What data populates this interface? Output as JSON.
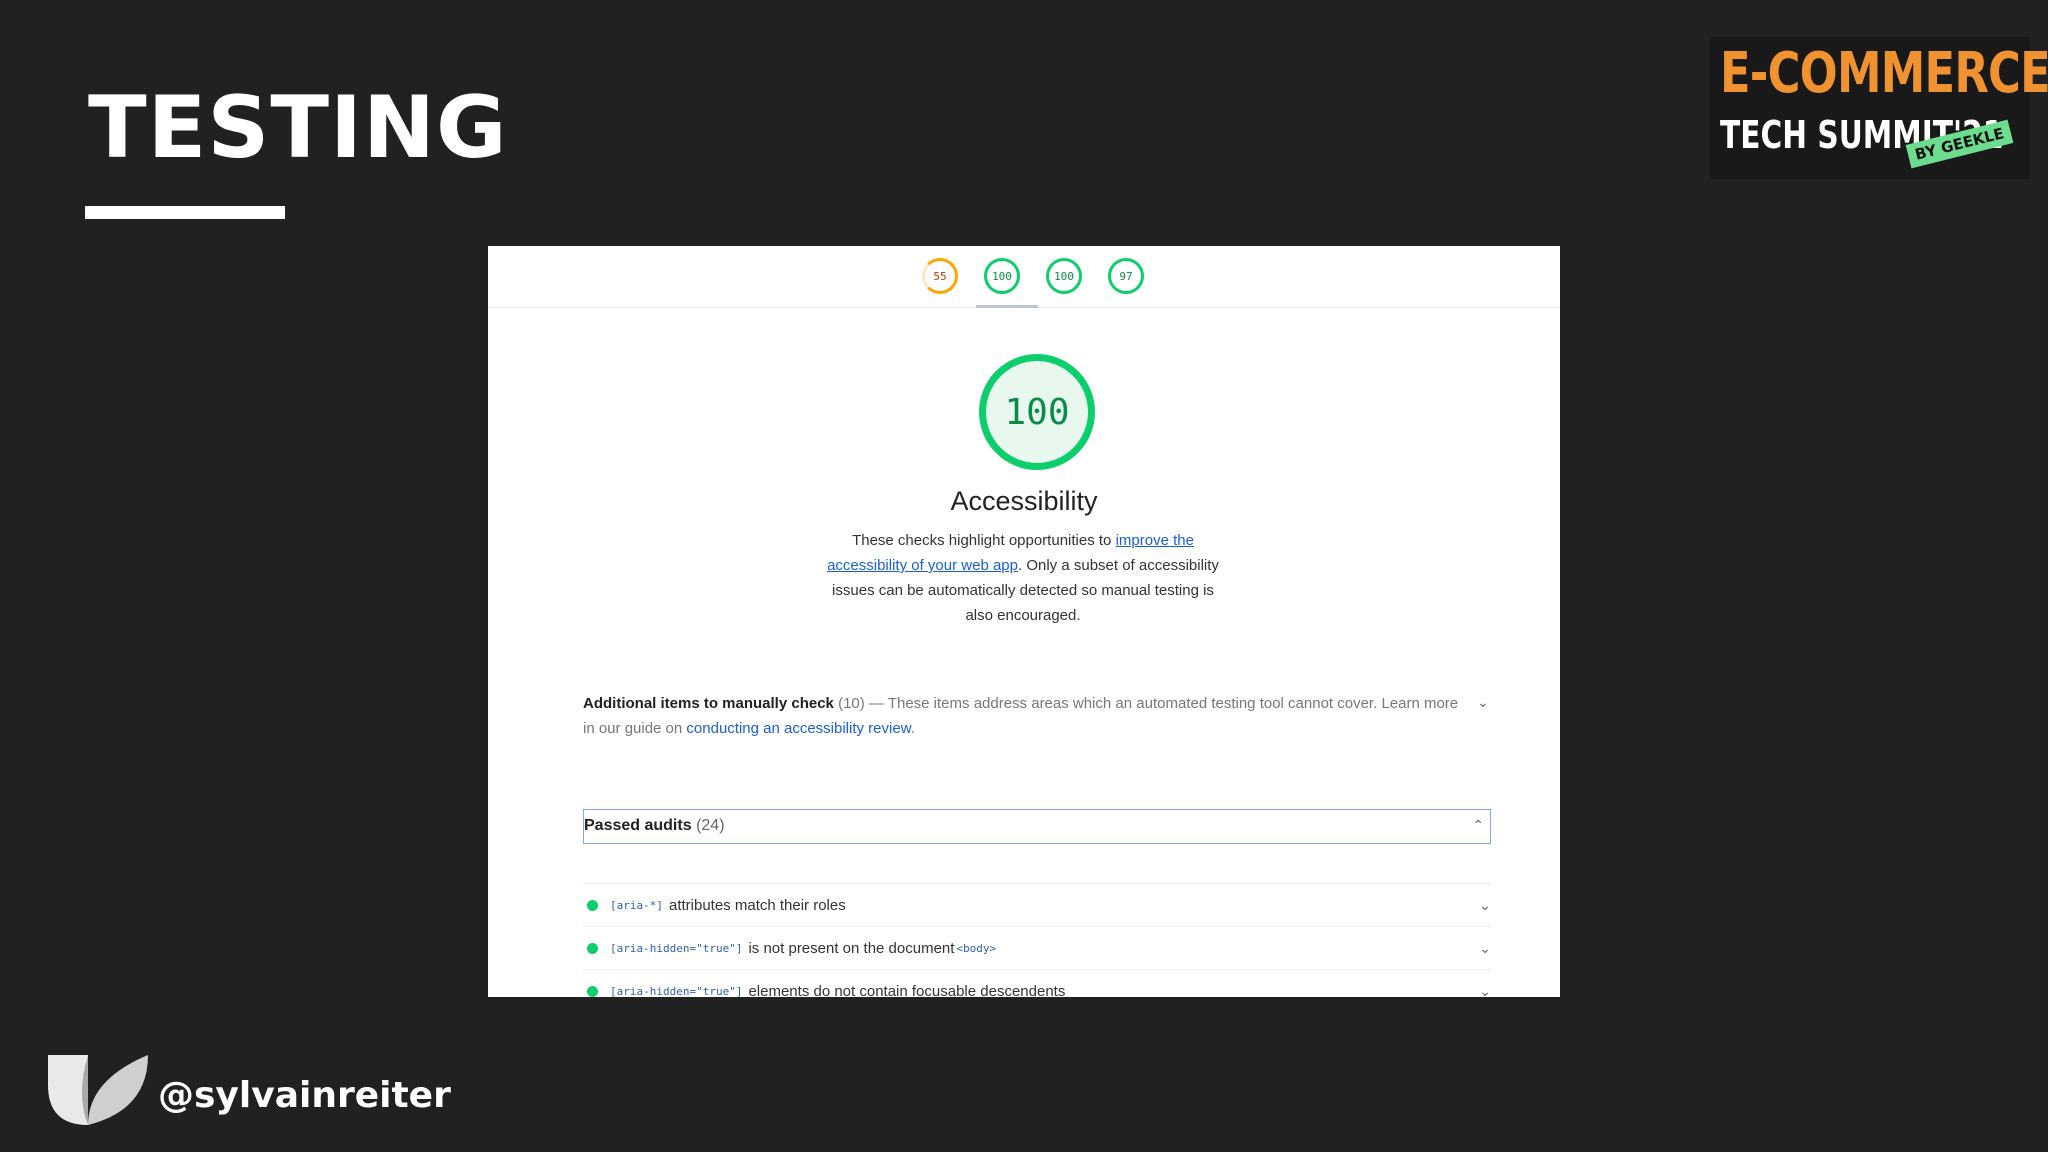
{
  "slide": {
    "title": "TESTING",
    "handle": "@sylvainreiter"
  },
  "logo": {
    "line1": "E-COMMERCE",
    "line2": "TECH SUMMIT'21",
    "badge": "BY GEEKLE"
  },
  "lighthouse": {
    "tabs": [
      {
        "score": "55",
        "color": "#ffa400"
      },
      {
        "score": "100",
        "color": "#0cce6b"
      },
      {
        "score": "100",
        "color": "#0cce6b"
      },
      {
        "score": "97",
        "color": "#0cce6b"
      }
    ],
    "gauge_score": "100",
    "category_title": "Accessibility",
    "desc_before": "These checks highlight opportunities to ",
    "desc_link": "improve the accessibility of your web app",
    "desc_after": ". Only a subset of accessibility issues can be automatically detected so manual testing is also encouraged.",
    "manual_title": "Additional items to manually check",
    "manual_count": "(10)",
    "manual_desc": " — These items address areas which an automated testing tool cannot cover. Learn more in our guide on ",
    "manual_link": "conducting an accessibility review",
    "manual_end": ".",
    "passed_label": "Passed audits",
    "passed_count": "(24)",
    "audits": [
      {
        "code": "[aria-*]",
        "text": "attributes match their roles",
        "tail": ""
      },
      {
        "code": "[aria-hidden=\"true\"]",
        "text": "is not present on the document ",
        "tail": "<body>"
      },
      {
        "code": "[aria-hidden=\"true\"]",
        "text": "elements do not contain focusable descendents",
        "tail": ""
      }
    ]
  }
}
